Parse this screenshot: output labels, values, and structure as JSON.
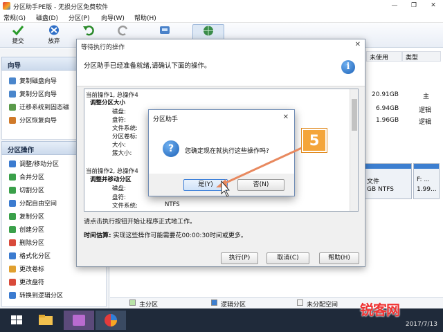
{
  "window": {
    "title": "分区助手PE版 - 无损分区免费软件"
  },
  "menu": [
    "常规(G)",
    "磁盘(D)",
    "分区(P)",
    "向导(W)",
    "帮助(H)"
  ],
  "toolbar": {
    "commit": "提交",
    "discard": "放弃"
  },
  "left": {
    "wizard_header": "向导",
    "wizard_items": [
      "复制磁盘向导",
      "复制分区向导",
      "迁移系统到固态磁",
      "分区恢复向导"
    ],
    "ops_header": "分区操作",
    "ops_items": [
      "调整/移动分区",
      "合并分区",
      "切割分区",
      "分配自由空间",
      "复制分区",
      "创建分区",
      "删除分区",
      "格式化分区",
      "更改卷标",
      "更改盘符",
      "转换到逻辑分区"
    ]
  },
  "table": {
    "headers": {
      "unused": "未使用",
      "type": "类型"
    },
    "rows": [
      {
        "unused": "20.91GB",
        "type": "主"
      },
      {
        "unused": "6.94GB",
        "type": "逻辑"
      },
      {
        "unused": "1.96GB",
        "type": "逻辑"
      }
    ],
    "disk_label_1": "文件",
    "disk_label_2": "GB NTFS",
    "disk_label_3": "F: ...",
    "disk_label_4": "1.99..."
  },
  "legend": {
    "primary": "主分区",
    "logical": "逻辑分区",
    "unallocated": "未分配空间"
  },
  "pending": {
    "title": "等待执行的操作",
    "message": "分区助手已经准备就绪,请确认下面的操作。",
    "op1_header": "当前操作1, 总操作4",
    "op1_title": "调整分区大小",
    "op1_fields": [
      "磁盘:",
      "盘符:",
      "文件系统:",
      "分区卷标:",
      "大小:",
      "簇大小:"
    ],
    "op2_header": "当前操作2, 总操作4",
    "op2_title": "调整并移动分区",
    "op2_fields": [
      "磁盘:",
      "盘符:",
      "文件系统:"
    ],
    "op2_fs": "NTFS",
    "note_run": "请点击执行按钮开始让程序正式地工作。",
    "time_label": "时间估算:",
    "time_text": "实现这些操作可能需要花00:00:30时间或更多。",
    "btn_run": "执行(P)",
    "btn_cancel": "取消(C)",
    "btn_help": "帮助(H)"
  },
  "confirm": {
    "title": "分区助手",
    "question": "您确定现在就执行这些操作吗?",
    "yes": "是(Y)",
    "no": "否(N)"
  },
  "annotation": {
    "step": "5"
  },
  "taskbar": {
    "date": "2017/7/13"
  },
  "watermark": "锐客网",
  "colors": {
    "accent": "#1d62b8",
    "badge": "#f4a53a",
    "taskbar": "#1f2a3a",
    "primary_legend": "#b9e3a8",
    "logical_legend": "#3d7fd0"
  }
}
